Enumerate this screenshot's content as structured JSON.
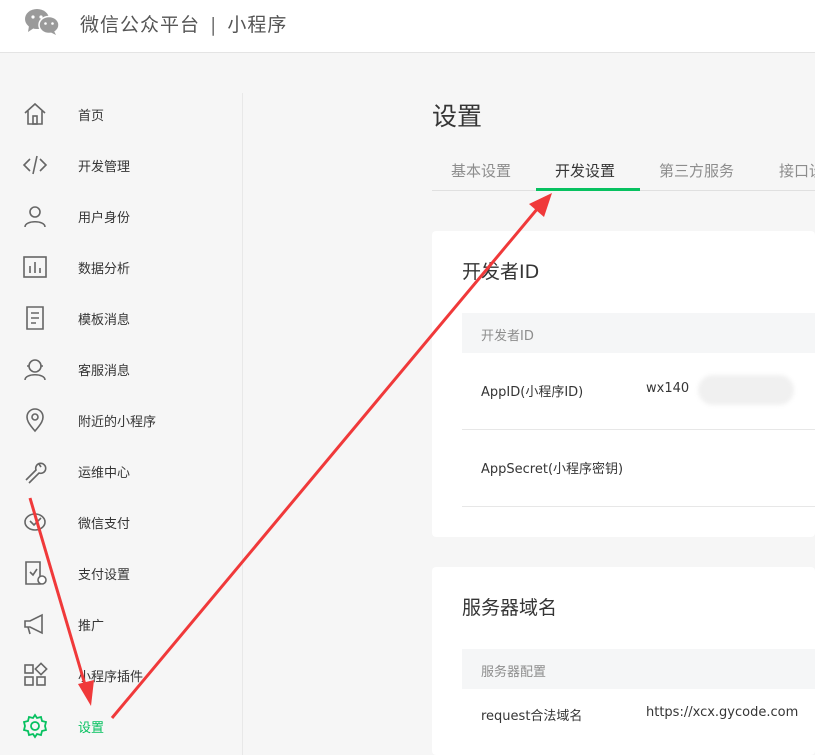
{
  "header": {
    "brand": "微信公众平台",
    "separator": "|",
    "product": "小程序"
  },
  "sidebar": {
    "items": [
      {
        "label": "首页",
        "icon": "home-icon"
      },
      {
        "label": "开发管理",
        "icon": "code-icon"
      },
      {
        "label": "用户身份",
        "icon": "user-icon"
      },
      {
        "label": "数据分析",
        "icon": "chart-icon"
      },
      {
        "label": "模板消息",
        "icon": "document-icon"
      },
      {
        "label": "客服消息",
        "icon": "headset-icon"
      },
      {
        "label": "附近的小程序",
        "icon": "location-pin-icon"
      },
      {
        "label": "运维中心",
        "icon": "wrench-icon"
      },
      {
        "label": "微信支付",
        "icon": "wallet-icon"
      },
      {
        "label": "支付设置",
        "icon": "payment-settings-icon"
      },
      {
        "label": "推广",
        "icon": "megaphone-icon"
      },
      {
        "label": "小程序插件",
        "icon": "plugin-grid-icon"
      },
      {
        "label": "设置",
        "icon": "gear-icon",
        "active": true
      }
    ]
  },
  "main": {
    "title": "设置",
    "tabs": [
      {
        "label": "基本设置"
      },
      {
        "label": "开发设置",
        "active": true
      },
      {
        "label": "第三方服务"
      },
      {
        "label": "接口设"
      }
    ],
    "developer_card": {
      "title": "开发者ID",
      "header": "开发者ID",
      "rows": [
        {
          "key": "AppID(小程序ID)",
          "value": "wx140"
        },
        {
          "key": "AppSecret(小程序密钥)",
          "value": ""
        }
      ]
    },
    "server_card": {
      "title": "服务器域名",
      "header": "服务器配置",
      "rows": [
        {
          "key": "request合法域名",
          "value": "https://xcx.gycode.com"
        }
      ]
    }
  },
  "colors": {
    "accent": "#07c160",
    "arrow": "#f0393a"
  }
}
